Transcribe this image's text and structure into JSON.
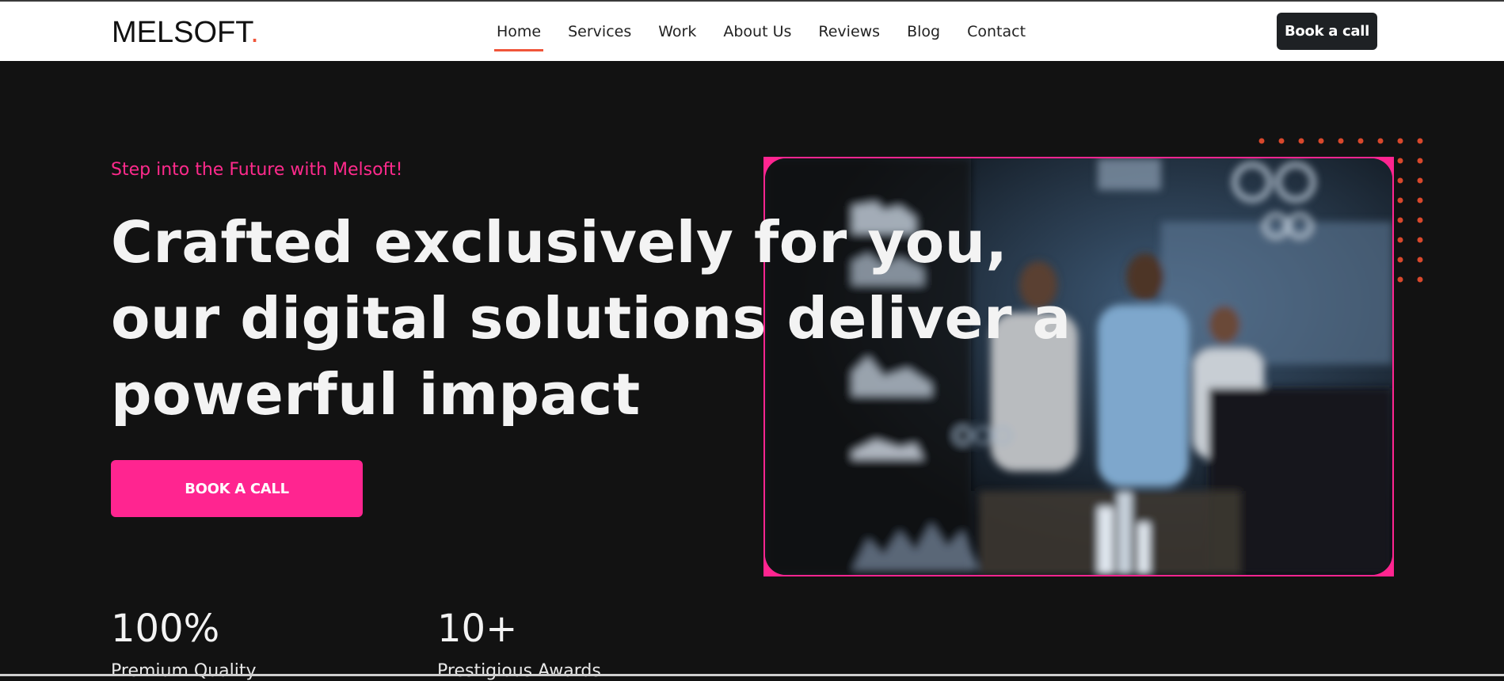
{
  "header": {
    "logo_text": "MELSOFT",
    "logo_dot": ".",
    "nav": [
      "Home",
      "Services",
      "Work",
      "About Us",
      "Reviews",
      "Blog",
      "Contact"
    ],
    "active_nav": "Home",
    "cta_label": "Book a call"
  },
  "hero": {
    "eyebrow": "Step into the Future with Melsoft!",
    "headline_lines": [
      "Crafted exclusively for you,",
      "our digital solutions deliver a",
      "powerful impact"
    ],
    "cta_label": "BOOK A CALL"
  },
  "stats": [
    {
      "value": "100%",
      "label": "Premium Quality"
    },
    {
      "value": "10+",
      "label": "Prestigious Awards"
    }
  ],
  "colors": {
    "accent_pink": "#ff2590",
    "accent_orange": "#f0553a",
    "background": "#121212"
  }
}
